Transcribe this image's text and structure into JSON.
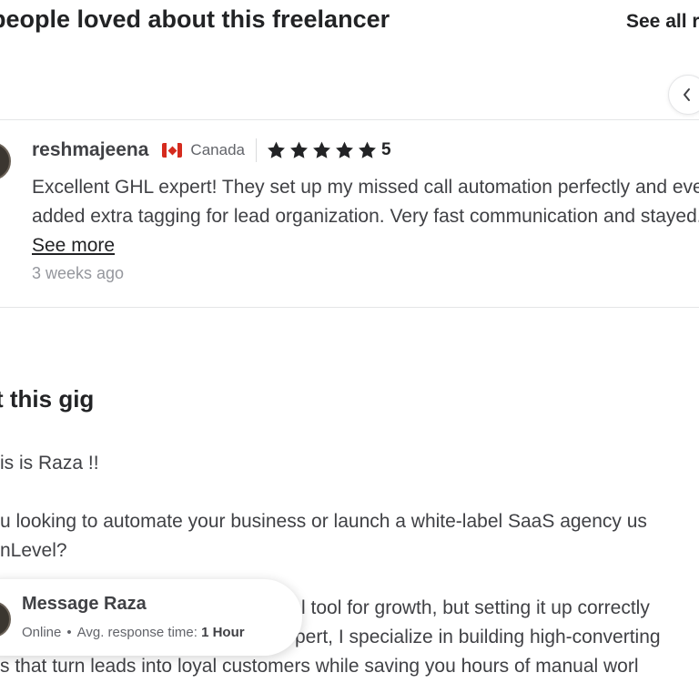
{
  "reviews_section": {
    "title": "people loved about this freelancer",
    "see_all_label": "See all r",
    "prev_icon": "chevron-left-icon"
  },
  "review": {
    "reviewer_name": "reshmajeena",
    "country": "Canada",
    "country_flag_icon": "canada-flag-icon",
    "rating": "5",
    "star_count": 5,
    "star_color": "#222325",
    "text": "Excellent GHL expert! They set up my missed call automation perfectly and even added extra tagging for lead organization. Very fast communication and stayed... ",
    "see_more_label": "See more",
    "time_ago": "3 weeks ago"
  },
  "about": {
    "title": "t this gig",
    "lines": [
      "is is Raza !!",
      "u looking to automate your business or launch a white-label SaaS agency us",
      "nLevel?",
      "l tool for growth, but setting it up correctly",
      "pert, I specialize in building high-converting",
      "s that turn leads into loyal customers while saving you hours of manual worl"
    ]
  },
  "message_card": {
    "title": "Message Raza",
    "status": "Online",
    "separator": "•",
    "response_label": "Avg. response time:",
    "response_value": "1 Hour"
  }
}
